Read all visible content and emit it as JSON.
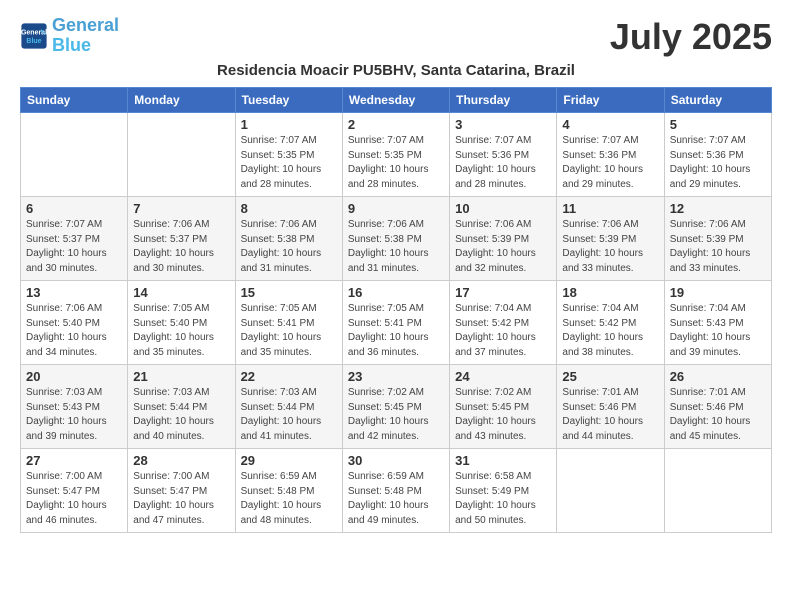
{
  "header": {
    "logo_line1": "General",
    "logo_line2": "Blue",
    "title": "July 2025",
    "subtitle": "Residencia Moacir PU5BHV, Santa Catarina, Brazil"
  },
  "weekdays": [
    "Sunday",
    "Monday",
    "Tuesday",
    "Wednesday",
    "Thursday",
    "Friday",
    "Saturday"
  ],
  "weeks": [
    [
      {
        "day": "",
        "info": ""
      },
      {
        "day": "",
        "info": ""
      },
      {
        "day": "1",
        "info": "Sunrise: 7:07 AM\nSunset: 5:35 PM\nDaylight: 10 hours\nand 28 minutes."
      },
      {
        "day": "2",
        "info": "Sunrise: 7:07 AM\nSunset: 5:35 PM\nDaylight: 10 hours\nand 28 minutes."
      },
      {
        "day": "3",
        "info": "Sunrise: 7:07 AM\nSunset: 5:36 PM\nDaylight: 10 hours\nand 28 minutes."
      },
      {
        "day": "4",
        "info": "Sunrise: 7:07 AM\nSunset: 5:36 PM\nDaylight: 10 hours\nand 29 minutes."
      },
      {
        "day": "5",
        "info": "Sunrise: 7:07 AM\nSunset: 5:36 PM\nDaylight: 10 hours\nand 29 minutes."
      }
    ],
    [
      {
        "day": "6",
        "info": "Sunrise: 7:07 AM\nSunset: 5:37 PM\nDaylight: 10 hours\nand 30 minutes."
      },
      {
        "day": "7",
        "info": "Sunrise: 7:06 AM\nSunset: 5:37 PM\nDaylight: 10 hours\nand 30 minutes."
      },
      {
        "day": "8",
        "info": "Sunrise: 7:06 AM\nSunset: 5:38 PM\nDaylight: 10 hours\nand 31 minutes."
      },
      {
        "day": "9",
        "info": "Sunrise: 7:06 AM\nSunset: 5:38 PM\nDaylight: 10 hours\nand 31 minutes."
      },
      {
        "day": "10",
        "info": "Sunrise: 7:06 AM\nSunset: 5:39 PM\nDaylight: 10 hours\nand 32 minutes."
      },
      {
        "day": "11",
        "info": "Sunrise: 7:06 AM\nSunset: 5:39 PM\nDaylight: 10 hours\nand 33 minutes."
      },
      {
        "day": "12",
        "info": "Sunrise: 7:06 AM\nSunset: 5:39 PM\nDaylight: 10 hours\nand 33 minutes."
      }
    ],
    [
      {
        "day": "13",
        "info": "Sunrise: 7:06 AM\nSunset: 5:40 PM\nDaylight: 10 hours\nand 34 minutes."
      },
      {
        "day": "14",
        "info": "Sunrise: 7:05 AM\nSunset: 5:40 PM\nDaylight: 10 hours\nand 35 minutes."
      },
      {
        "day": "15",
        "info": "Sunrise: 7:05 AM\nSunset: 5:41 PM\nDaylight: 10 hours\nand 35 minutes."
      },
      {
        "day": "16",
        "info": "Sunrise: 7:05 AM\nSunset: 5:41 PM\nDaylight: 10 hours\nand 36 minutes."
      },
      {
        "day": "17",
        "info": "Sunrise: 7:04 AM\nSunset: 5:42 PM\nDaylight: 10 hours\nand 37 minutes."
      },
      {
        "day": "18",
        "info": "Sunrise: 7:04 AM\nSunset: 5:42 PM\nDaylight: 10 hours\nand 38 minutes."
      },
      {
        "day": "19",
        "info": "Sunrise: 7:04 AM\nSunset: 5:43 PM\nDaylight: 10 hours\nand 39 minutes."
      }
    ],
    [
      {
        "day": "20",
        "info": "Sunrise: 7:03 AM\nSunset: 5:43 PM\nDaylight: 10 hours\nand 39 minutes."
      },
      {
        "day": "21",
        "info": "Sunrise: 7:03 AM\nSunset: 5:44 PM\nDaylight: 10 hours\nand 40 minutes."
      },
      {
        "day": "22",
        "info": "Sunrise: 7:03 AM\nSunset: 5:44 PM\nDaylight: 10 hours\nand 41 minutes."
      },
      {
        "day": "23",
        "info": "Sunrise: 7:02 AM\nSunset: 5:45 PM\nDaylight: 10 hours\nand 42 minutes."
      },
      {
        "day": "24",
        "info": "Sunrise: 7:02 AM\nSunset: 5:45 PM\nDaylight: 10 hours\nand 43 minutes."
      },
      {
        "day": "25",
        "info": "Sunrise: 7:01 AM\nSunset: 5:46 PM\nDaylight: 10 hours\nand 44 minutes."
      },
      {
        "day": "26",
        "info": "Sunrise: 7:01 AM\nSunset: 5:46 PM\nDaylight: 10 hours\nand 45 minutes."
      }
    ],
    [
      {
        "day": "27",
        "info": "Sunrise: 7:00 AM\nSunset: 5:47 PM\nDaylight: 10 hours\nand 46 minutes."
      },
      {
        "day": "28",
        "info": "Sunrise: 7:00 AM\nSunset: 5:47 PM\nDaylight: 10 hours\nand 47 minutes."
      },
      {
        "day": "29",
        "info": "Sunrise: 6:59 AM\nSunset: 5:48 PM\nDaylight: 10 hours\nand 48 minutes."
      },
      {
        "day": "30",
        "info": "Sunrise: 6:59 AM\nSunset: 5:48 PM\nDaylight: 10 hours\nand 49 minutes."
      },
      {
        "day": "31",
        "info": "Sunrise: 6:58 AM\nSunset: 5:49 PM\nDaylight: 10 hours\nand 50 minutes."
      },
      {
        "day": "",
        "info": ""
      },
      {
        "day": "",
        "info": ""
      }
    ]
  ]
}
